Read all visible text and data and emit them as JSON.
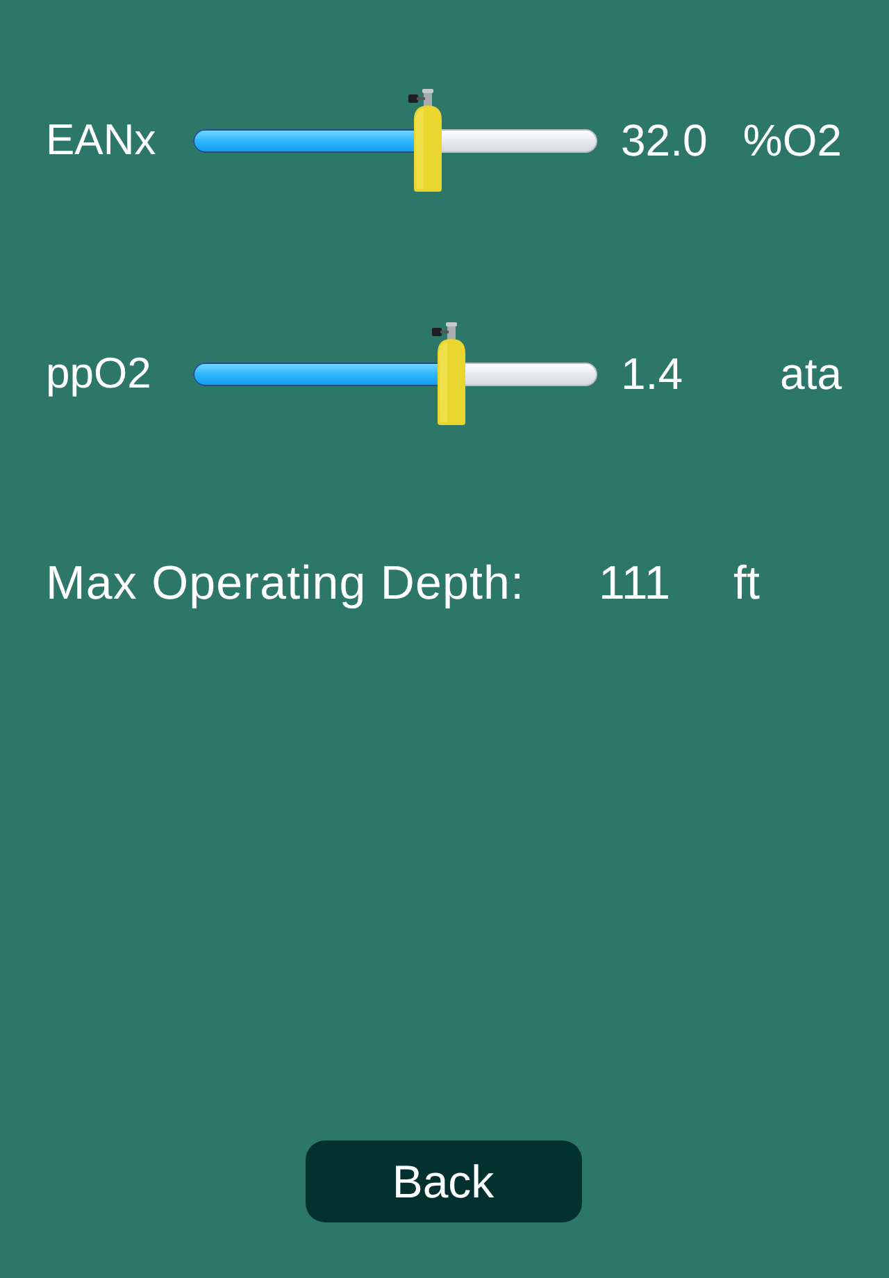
{
  "sliders": [
    {
      "label": "EANx",
      "level": 0.58,
      "value": "32.0",
      "unit": "%O2"
    },
    {
      "label": "ppO2",
      "level": 0.64,
      "value": "1.4",
      "unit": "ata"
    }
  ],
  "max_operating_depth": {
    "label": "Max Operating Depth:",
    "value": "111",
    "unit": "ft"
  },
  "buttons": [
    {
      "label": "Back"
    }
  ]
}
